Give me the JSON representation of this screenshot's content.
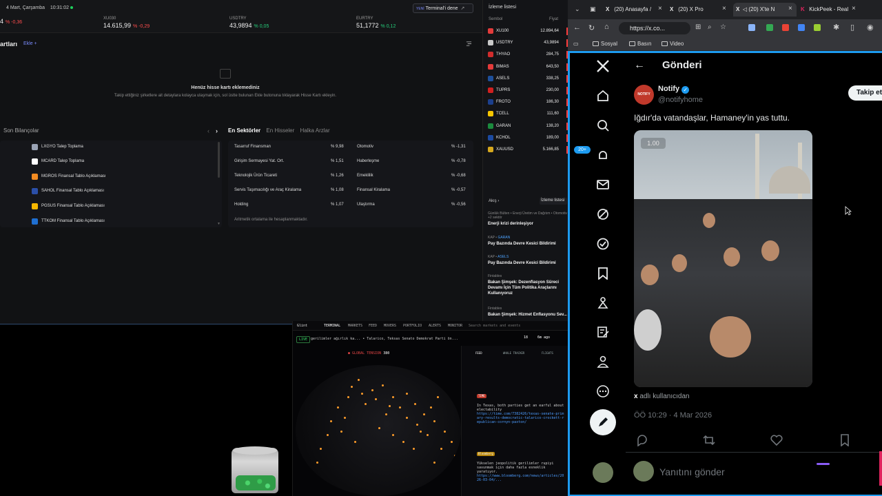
{
  "finance": {
    "date": "4 Mart, Çarşamba",
    "time": "10:31:02",
    "yeni_tag": "YENİ",
    "terminal_btn": "Terminal'i dene",
    "terminal_arrow": "↗",
    "tickers": [
      {
        "name": "",
        "value": "4",
        "change": "% -0,36"
      },
      {
        "name": "XU030",
        "value": "14.615,99",
        "change": "% -0,29"
      },
      {
        "name": "USDTRY",
        "value": "43,9894",
        "change": "% 0,05"
      },
      {
        "name": "EURTRY",
        "value": "51,1772",
        "change": "% 0,12"
      }
    ],
    "section_title": "artları",
    "ekle": "Ekle  +",
    "empty_title": "Henüz hisse kartı eklemediniz",
    "empty_sub": "Takip ettiğiniz şirketlere ait detaylara kolayca ulaşmak için, sol üstte bulunan Ekle butonuna tıklayarak Hisse Kartı ekleyin.",
    "bilancolar_title": "Son Bilançolar",
    "pager_prev": "‹",
    "pager_next": "›",
    "tabs": [
      "En Sektörler",
      "En Hisseler",
      "Halka Arzlar"
    ],
    "bilancolar": [
      {
        "label": "LXGYO Talep Toplama",
        "logo": "#9aa3b5"
      },
      {
        "label": "MCARD Talep Toplama",
        "logo": "#ffffff"
      },
      {
        "label": "MGROS Finansal Tablo Açıklaması",
        "logo": "#f28b22"
      },
      {
        "label": "SAHOL Finansal Tablo Açıklaması",
        "logo": "#2b4fa8"
      },
      {
        "label": "PGSUS Finansal Tablo Açıklaması",
        "logo": "#f5b700"
      },
      {
        "label": "TTKOM Finansal Tablo Açıklaması",
        "logo": "#1f6fd1"
      }
    ],
    "sectors_left": [
      {
        "name": "Tasarruf Finansman",
        "pct": "% 9,98"
      },
      {
        "name": "Girişim Sermayesi Yat. Ort.",
        "pct": "% 1,51"
      },
      {
        "name": "Teknolojik Ürün Ticareti",
        "pct": "% 1,26"
      },
      {
        "name": "Servis Taşımacılığı ve Araç Kiralama",
        "pct": "% 1,08"
      },
      {
        "name": "Holding",
        "pct": "% 1,07"
      }
    ],
    "sectors_right": [
      {
        "name": "Otomotiv",
        "pct": "% -1,31"
      },
      {
        "name": "Haberleşme",
        "pct": "% -0,78"
      },
      {
        "name": "Emeklilik",
        "pct": "% -0,68"
      },
      {
        "name": "Finansal Kiralama",
        "pct": "% -0,57"
      },
      {
        "name": "Ulaştırma",
        "pct": "% -0,56"
      }
    ],
    "sector_note": "Aritmetik ortalama ile hesaplanmaktadır."
  },
  "watchlist": {
    "title": "İzleme listesi",
    "col_symbol": "Sembol",
    "col_price": "Fiyat",
    "rows": [
      {
        "sym": "XU100",
        "price": "12.894,64",
        "color": "#e23b3b"
      },
      {
        "sym": "USDTRY",
        "price": "43,9894",
        "color": "#c9c9c9"
      },
      {
        "sym": "THYAO",
        "price": "284,75",
        "color": "#d12c2c"
      },
      {
        "sym": "BIMAS",
        "price": "643,50",
        "color": "#e43a3a"
      },
      {
        "sym": "ASELS",
        "price": "338,25",
        "color": "#1e4f9a"
      },
      {
        "sym": "TUPRS",
        "price": "230,00",
        "color": "#d02020"
      },
      {
        "sym": "FROTO",
        "price": "186,30",
        "color": "#1c3f8c"
      },
      {
        "sym": "TCELL",
        "price": "111,60",
        "color": "#f7c600"
      },
      {
        "sym": "GARAN",
        "price": "138,20",
        "color": "#1b8a3d"
      },
      {
        "sym": "KCHOL",
        "price": "189,00",
        "color": "#1c4aa0"
      },
      {
        "sym": "XAUUSD",
        "price": "5.166,85",
        "color": "#d6a81e"
      }
    ],
    "akis": "Akış  ›",
    "izleme_btn": "İzleme listesi",
    "news": [
      {
        "src": "Günlük Bülten • Enerji Üretim ve Dağıtım • Otomotiv +2 sektör",
        "tag": "",
        "head": "Enerji krizi derinleşiyor"
      },
      {
        "src": "KAP • ",
        "tag": "GARAN",
        "head": "Pay Bazında Devre Kesici Bildirimi"
      },
      {
        "src": "KAP • ",
        "tag": "ASELS",
        "head": "Pay Bazında Devre Kesici Bildirimi"
      },
      {
        "src": "Fintables",
        "tag": "",
        "head": "Bakan Şimşek: Dezenflasyon Süreci Devamı İçin Tüm Politika Araçlarını Kullanıyoruz"
      },
      {
        "src": "Fintables",
        "tag": "",
        "head": "Bakan Şimşek: Hizmet Enflasyonu Sev..."
      }
    ]
  },
  "glint": {
    "brand": "Glint",
    "nav": [
      "TERMINAL",
      "MARKETS",
      "FEED",
      "MOVERS",
      "PORTFOLIO",
      "ALERTS",
      "MONITOR"
    ],
    "search": "Search markets and events",
    "live": "LIVE",
    "ticker_text": "gerilimler ağırlık ka... • Talarico, Teksas Senato Demokrat Parti ön...",
    "count": "18",
    "ago": "6m ago",
    "tension_label": "GLOBAL TENSION",
    "tension_value": "380",
    "feed_tab": "FEED",
    "whale_tab": "WHALE TRACKER",
    "flights_tab": "FLIGHTS",
    "item1_src": "TIME",
    "item1_text": "In Texas, both parties get an earful about electability",
    "item1_link": "https://time.com/7382426/texas-senate-primary-results-democratic-talarico-crockett-republican-cornyn-paxton/",
    "item2_src": "Bloomberg",
    "item2_text": "Yükselen jeopolitik gerilimler rupiyi savunmak için daha fazla esneklik yaratıyor.",
    "item2_link": "https://www.bloomberg.com/news/articles/2026-03-04/..."
  },
  "browser": {
    "tabs": [
      {
        "label": "(20) Anasayfa /",
        "icon": "X"
      },
      {
        "label": "(20) X Pro",
        "icon": "X"
      },
      {
        "label": "(20) X'te N",
        "icon": "X"
      },
      {
        "label": "KickPeek - Real",
        "icon": "K"
      }
    ],
    "url": "https://x.co...",
    "bookmarks": [
      "Sosyal",
      "Basın",
      "Video"
    ]
  },
  "x": {
    "page_title": "Gönderi",
    "notif_badge": "20+",
    "author": "Notify",
    "avatar_text": "NOTIFY",
    "handle": "@notifyhome",
    "follow": "Takip et",
    "text": "Iğdır'da vatandaşlar, Hamaney'in yas tuttu.",
    "speed": "1.00",
    "caption_user": "x",
    "caption_rest": " adlı kullanıcıdan",
    "timestamp": "ÖÖ 10:29 · 4 Mar 2026",
    "reply_placeholder": "Yanıtını gönder"
  }
}
